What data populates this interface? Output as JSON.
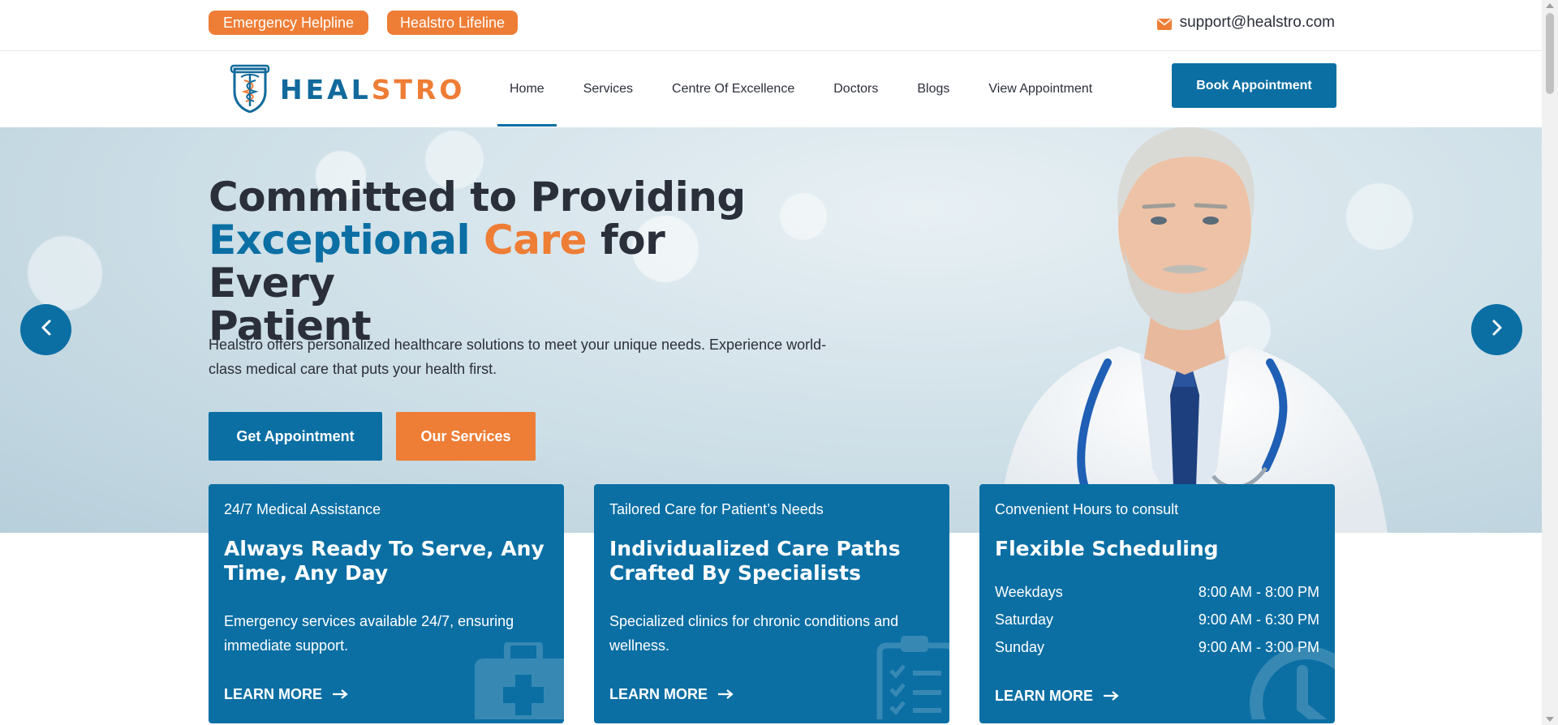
{
  "topbar": {
    "emergency_label": "Emergency Helpline",
    "lifeline_label": "Healstro Lifeline",
    "email": "support@healstro.com",
    "email_icon": "envelope-icon"
  },
  "brand": {
    "logo_part1": "HEAL",
    "logo_part2": "STRO",
    "logo_icon": "caduceus-shield-icon"
  },
  "nav": {
    "items": [
      {
        "label": "Home",
        "active": true
      },
      {
        "label": "Services"
      },
      {
        "label": "Centre Of Excellence"
      },
      {
        "label": "Doctors"
      },
      {
        "label": "Blogs"
      },
      {
        "label": "View Appointment"
      }
    ],
    "book_label": "Book Appointment"
  },
  "hero": {
    "title_line1": "Committed to Providing",
    "title_blue": "Exceptional",
    "title_orange": "Care",
    "title_rest": "for Every",
    "title_line3": "Patient",
    "description": "Healstro offers personalized healthcare solutions to meet your unique needs. Experience world-class medical care that puts your health first.",
    "primary_cta": "Get Appointment",
    "secondary_cta": "Our Services",
    "prev_icon": "chevron-left-icon",
    "next_icon": "chevron-right-icon"
  },
  "cards": [
    {
      "kicker": "24/7 Medical Assistance",
      "title": "Always Ready To Serve, Any Time, Any Day",
      "text": "Emergency services available 24/7, ensuring immediate support.",
      "link": "LEARN MORE",
      "icon": "medical-kit-icon"
    },
    {
      "kicker": "Tailored Care for Patient’s Needs",
      "title": "Individualized Care Paths Crafted By Specialists",
      "text": "Specialized clinics for chronic conditions and wellness.",
      "link": "LEARN MORE",
      "icon": "clipboard-checklist-icon"
    },
    {
      "kicker": "Convenient Hours to consult",
      "title": "Flexible Scheduling",
      "hours": [
        {
          "day": "Weekdays",
          "time": "8:00 AM - 8:00 PM"
        },
        {
          "day": "Saturday",
          "time": "9:00 AM - 6:30 PM"
        },
        {
          "day": "Sunday",
          "time": "9:00 AM - 3:00 PM"
        }
      ],
      "link": "LEARN MORE",
      "icon": "clock-icon"
    }
  ],
  "colors": {
    "primary": "#0b6fa4",
    "accent": "#ee7d35",
    "text": "#2b2f3a"
  }
}
